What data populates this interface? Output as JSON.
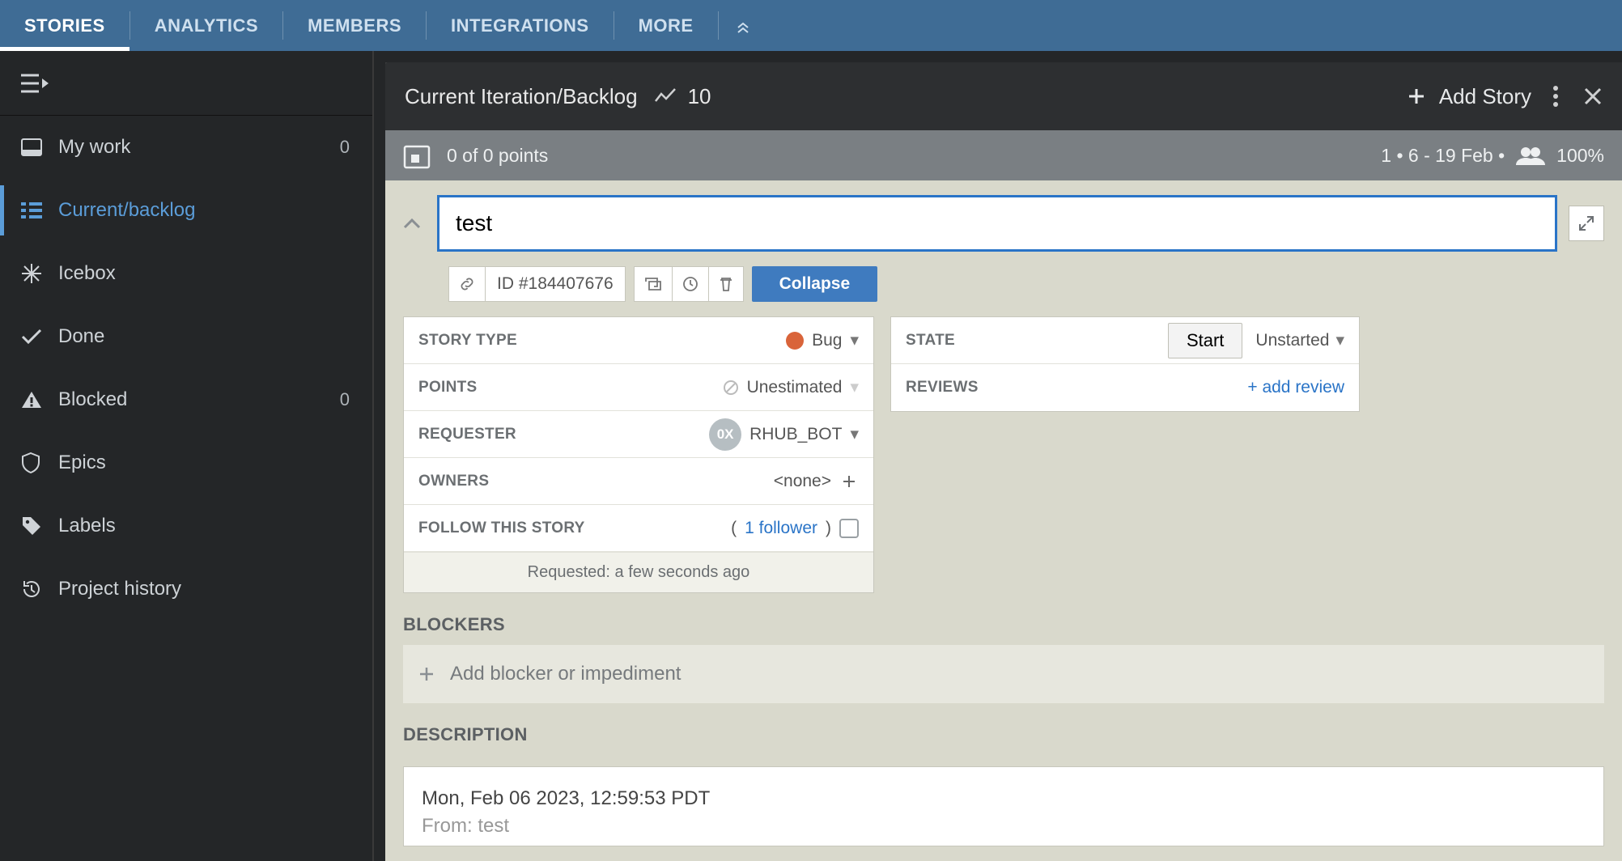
{
  "topnav": {
    "tabs": [
      "STORIES",
      "ANALYTICS",
      "MEMBERS",
      "INTEGRATIONS",
      "MORE"
    ],
    "active_index": 0
  },
  "sidebar": {
    "items": [
      {
        "label": "My work",
        "count": "0"
      },
      {
        "label": "Current/backlog"
      },
      {
        "label": "Icebox"
      },
      {
        "label": "Done"
      },
      {
        "label": "Blocked",
        "count": "0"
      },
      {
        "label": "Epics"
      },
      {
        "label": "Labels"
      },
      {
        "label": "Project history"
      }
    ],
    "active_index": 1
  },
  "panel": {
    "title": "Current Iteration/Backlog",
    "iteration_count": "10",
    "add_story_label": "Add Story",
    "points_text": "0 of 0 points",
    "iter_info": "1 • 6 - 19 Feb •",
    "capacity": "100%"
  },
  "story": {
    "title_value": "test",
    "id_label": "ID",
    "id_value": "#184407676",
    "collapse_label": "Collapse",
    "rows": {
      "story_type": {
        "label": "STORY TYPE",
        "value": "Bug"
      },
      "points": {
        "label": "POINTS",
        "value": "Unestimated"
      },
      "requester": {
        "label": "REQUESTER",
        "value": "RHUB_BOT",
        "avatar": "0X"
      },
      "owners": {
        "label": "OWNERS",
        "value": "<none>"
      },
      "follow": {
        "label": "FOLLOW THIS STORY",
        "prefix": "(",
        "link": "1 follower",
        "suffix": ")"
      }
    },
    "requested_text": "Requested: a few seconds ago",
    "state": {
      "label": "STATE",
      "button": "Start",
      "value": "Unstarted"
    },
    "reviews": {
      "label": "REVIEWS",
      "add": "+ add review"
    },
    "blockers": {
      "title": "BLOCKERS",
      "placeholder": "Add blocker or impediment"
    },
    "description": {
      "title": "DESCRIPTION",
      "line1": "Mon, Feb 06 2023, 12:59:53 PDT",
      "line2": "From: test"
    }
  }
}
